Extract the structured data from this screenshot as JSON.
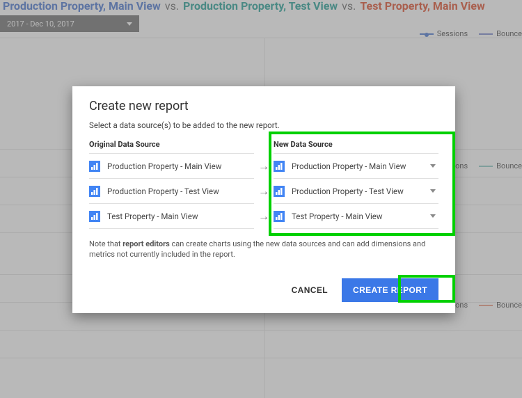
{
  "background": {
    "header": {
      "view_a": "Production Property, Main View",
      "view_b": "Production Property, Test View",
      "view_c": "Test Property, Main View",
      "vs": "vs."
    },
    "date_range": "2017 - Dec 10, 2017",
    "legend": {
      "sessions": "Sessions",
      "bounce": "Bounce",
      "ssions_cut": "ssions"
    }
  },
  "dialog": {
    "title": "Create new report",
    "subtitle": "Select a data source(s) to be added to the new report.",
    "col_original": "Original Data Source",
    "col_new": "New Data Source",
    "rows": [
      {
        "original": "Production Property - Main View",
        "selected": "Production Property - Main View"
      },
      {
        "original": "Production Property - Test View",
        "selected": "Production Property - Test View"
      },
      {
        "original": "Test Property - Main View",
        "selected": "Test Property - Main View"
      }
    ],
    "note_pre": "Note that ",
    "note_bold": "report editors",
    "note_post": " can create charts using the new data sources and can add dimensions and metrics not currently included in the report.",
    "cancel": "CANCEL",
    "create": "CREATE REPORT"
  }
}
